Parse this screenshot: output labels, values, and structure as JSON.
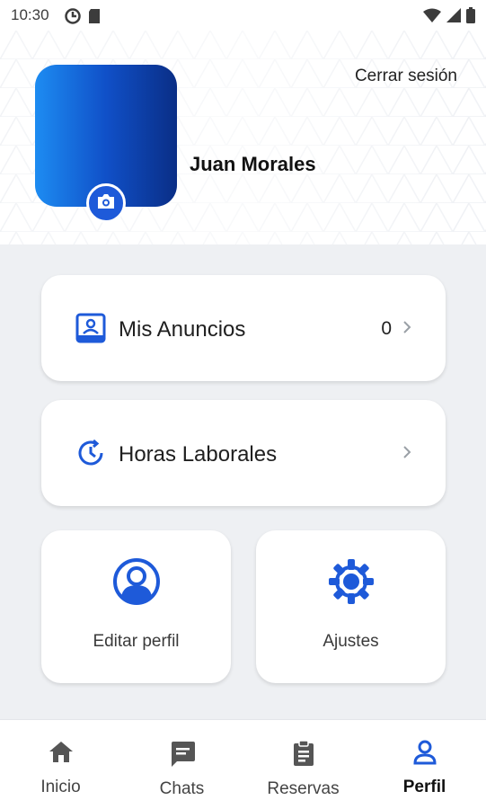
{
  "status_bar": {
    "time": "10:30",
    "left_icons": [
      "data-saver-icon",
      "sd-card-icon"
    ],
    "right_icons": [
      "wifi-icon",
      "signal-icon",
      "battery-icon"
    ]
  },
  "profile": {
    "name": "Juan Morales",
    "logout_label": "Cerrar sesión",
    "avatar_gradient": [
      "#1d8cf2",
      "#0a2e86"
    ],
    "camera_icon": "camera-icon"
  },
  "rows": [
    {
      "icon": "listing-icon",
      "label": "Mis Anuncios",
      "count": "0"
    },
    {
      "icon": "clock-icon",
      "label": "Horas Laborales",
      "count": ""
    }
  ],
  "tiles": [
    {
      "icon": "user-circle-icon",
      "label": "Editar perfil"
    },
    {
      "icon": "gear-icon",
      "label": "Ajustes"
    }
  ],
  "bottom_nav": {
    "items": [
      {
        "icon": "home-icon",
        "label": "Inicio"
      },
      {
        "icon": "chat-icon",
        "label": "Chats"
      },
      {
        "icon": "clipboard-icon",
        "label": "Reservas"
      },
      {
        "icon": "person-icon",
        "label": "Perfil"
      }
    ],
    "active": "Perfil"
  },
  "colors": {
    "accent": "#1e5ad9",
    "background": "#eef0f3",
    "card": "#ffffff",
    "nav_icon": "#555555"
  }
}
